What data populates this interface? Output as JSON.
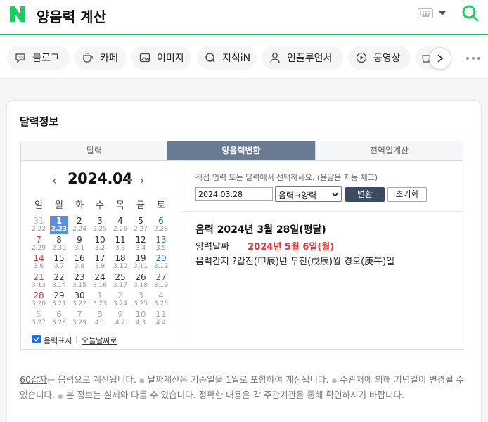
{
  "header": {
    "title": "양음력 계산",
    "brand_color": "#19ce60"
  },
  "tabs": [
    {
      "label": "블로그",
      "icon": "blog-icon"
    },
    {
      "label": "카페",
      "icon": "cafe-icon"
    },
    {
      "label": "이미지",
      "icon": "image-icon"
    },
    {
      "label": "지식iN",
      "icon": "kin-icon"
    },
    {
      "label": "인플루언서",
      "icon": "person-icon"
    },
    {
      "label": "동영상",
      "icon": "play-icon"
    }
  ],
  "section": {
    "title": "달력정보"
  },
  "subtabs": [
    {
      "label": "달력"
    },
    {
      "label": "양음력변환",
      "active": true
    },
    {
      "label": "전역일계산"
    }
  ],
  "calendar": {
    "month_label": "2024.04",
    "prev": "‹",
    "next": "›",
    "weekdays": [
      "일",
      "월",
      "화",
      "수",
      "목",
      "금",
      "토"
    ],
    "weeks": [
      [
        [
          "31",
          "2.22",
          true
        ],
        [
          "1",
          "2.23",
          false
        ],
        [
          "2",
          "2.24",
          false
        ],
        [
          "3",
          "2.25",
          false
        ],
        [
          "4",
          "2.26",
          false
        ],
        [
          "5",
          "2.27",
          false
        ],
        [
          "6",
          "2.28",
          false
        ]
      ],
      [
        [
          "7",
          "2.29",
          false
        ],
        [
          "8",
          "2.30",
          false
        ],
        [
          "9",
          "3.1",
          false
        ],
        [
          "10",
          "3.2",
          false
        ],
        [
          "11",
          "3.3",
          false
        ],
        [
          "12",
          "3.4",
          false
        ],
        [
          "13",
          "3.5",
          false
        ]
      ],
      [
        [
          "14",
          "3.6",
          false
        ],
        [
          "15",
          "3.7",
          false
        ],
        [
          "16",
          "3.8",
          false
        ],
        [
          "17",
          "3.9",
          false
        ],
        [
          "18",
          "3.10",
          false
        ],
        [
          "19",
          "3.11",
          false
        ],
        [
          "20",
          "3.12",
          false
        ]
      ],
      [
        [
          "21",
          "3.13",
          false
        ],
        [
          "22",
          "3.14",
          false
        ],
        [
          "23",
          "3.15",
          false
        ],
        [
          "24",
          "3.16",
          false
        ],
        [
          "25",
          "3.17",
          false
        ],
        [
          "26",
          "3.18",
          false
        ],
        [
          "27",
          "3.19",
          false
        ]
      ],
      [
        [
          "28",
          "3.20",
          false
        ],
        [
          "29",
          "3.21",
          false
        ],
        [
          "30",
          "3.22",
          false
        ],
        [
          "1",
          "3.23",
          true
        ],
        [
          "2",
          "3.24",
          true
        ],
        [
          "3",
          "3.25",
          true
        ],
        [
          "4",
          "3.26",
          true
        ]
      ],
      [
        [
          "5",
          "3.27",
          true
        ],
        [
          "6",
          "3.28",
          true
        ],
        [
          "7",
          "3.29",
          true
        ],
        [
          "8",
          "4.1",
          true
        ],
        [
          "9",
          "4.2",
          true
        ],
        [
          "10",
          "4.3",
          true
        ],
        [
          "11",
          "4.4",
          true
        ]
      ]
    ],
    "selected": [
      0,
      1
    ],
    "show_lunar_label": "음력표시",
    "show_lunar_checked": true,
    "today_label": "오늘날짜로"
  },
  "converter": {
    "hint": "직접 입력 또는 달력에서 선택하세요. (윤달은 자동 체크)",
    "input_value": "2024.03.28",
    "direction": "음력→양력",
    "convert_label": "변환",
    "reset_label": "초기화",
    "result_head": "음력 2024년 3월 28일(평달)",
    "solar_label": "양력날짜",
    "solar_value": "2024년 5월 6일(월)",
    "ganji_line": "음력간지 ?갑진(甲辰)년 무진(戊辰)월 경오(庚午)일"
  },
  "disclaimer": {
    "link": "60갑자",
    "text1": "는 음력으로 계산됩니다.",
    "text2": "날짜계산은 기준일을 1일로 포함하여 계산됩니다.",
    "text3": "주관처에 의해 기념일이 변경될 수 있습니다.",
    "text4": "본 정보는 실제와 다를 수 있습니다. 정확한 내용은 각 주관기관을 통해 확인하시기 바랍니다."
  }
}
